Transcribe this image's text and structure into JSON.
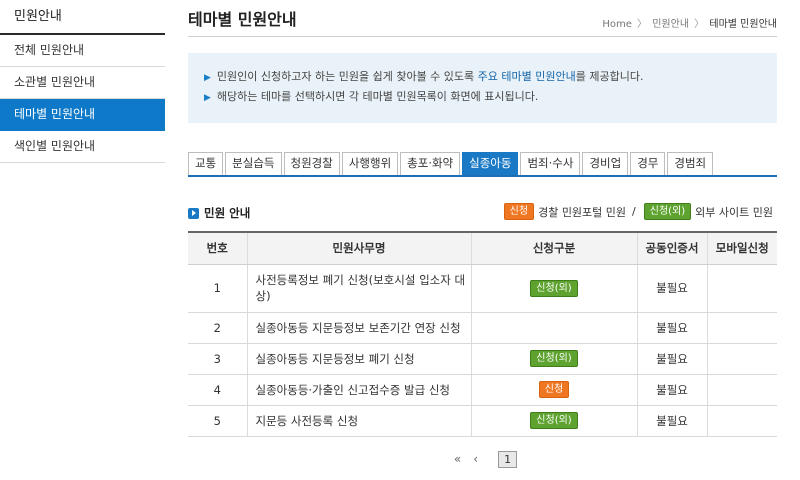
{
  "sidebar": {
    "title": "민원안내",
    "items": [
      {
        "label": "전체 민원안내"
      },
      {
        "label": "소관별 민원안내"
      },
      {
        "label": "테마별 민원안내"
      },
      {
        "label": "색인별 민원안내"
      }
    ]
  },
  "header": {
    "title": "테마별 민원안내",
    "breadcrumb": [
      "Home",
      "민원안내",
      "테마별 민원안내"
    ],
    "separator": "〉"
  },
  "notice": {
    "bullet": "▶",
    "line1_prefix": "민원인이 신청하고자 하는 민원을 쉽게 찾아볼 수 있도록 ",
    "line1_emphasis": "주요 테마별 민원안내",
    "line1_suffix": "를 제공합니다.",
    "line2": "해당하는 테마를 선택하시면 각 테마별 민원목록이 화면에 표시됩니다."
  },
  "tabs": [
    {
      "label": "교통"
    },
    {
      "label": "분실습득"
    },
    {
      "label": "청원경찰"
    },
    {
      "label": "사행행위"
    },
    {
      "label": "총포·화약"
    },
    {
      "label": "실종아동"
    },
    {
      "label": "범죄·수사"
    },
    {
      "label": "경비업"
    },
    {
      "label": "경무"
    },
    {
      "label": "경범죄"
    }
  ],
  "active_tab": "실종아동",
  "section": {
    "title": "민원 안내",
    "legend": {
      "orange_badge": "신청",
      "orange_label": "경찰 민원포털 민원",
      "slash": "/",
      "green_badge": "신청(외)",
      "green_label": "외부 사이트 민원"
    }
  },
  "table": {
    "headers": [
      "번호",
      "민원사무명",
      "신청구분",
      "공동인증서",
      "모바일신청"
    ],
    "rows": [
      {
        "no": "1",
        "name": "사전등록정보 폐기 신청(보호시설 입소자 대상)",
        "apply": "신청(외)",
        "apply_type": "green",
        "cert": "불필요",
        "mobile": ""
      },
      {
        "no": "2",
        "name": "실종아동등 지문등정보 보존기간 연장 신청",
        "apply": "",
        "apply_type": "",
        "cert": "불필요",
        "mobile": ""
      },
      {
        "no": "3",
        "name": "실종아동등 지문등정보 폐기 신청",
        "apply": "신청(외)",
        "apply_type": "green",
        "cert": "불필요",
        "mobile": ""
      },
      {
        "no": "4",
        "name": "실종아동등·가출인 신고접수증 발급 신청",
        "apply": "신청",
        "apply_type": "orange",
        "cert": "불필요",
        "mobile": ""
      },
      {
        "no": "5",
        "name": "지문등 사전등록 신청",
        "apply": "신청(외)",
        "apply_type": "green",
        "cert": "불필요",
        "mobile": ""
      }
    ]
  },
  "pagination": {
    "first": "«",
    "prev": "‹",
    "current": "1"
  },
  "colors": {
    "accent_blue": "#1a79c5",
    "badge_orange": "#f07722",
    "badge_green": "#5ea22f"
  }
}
